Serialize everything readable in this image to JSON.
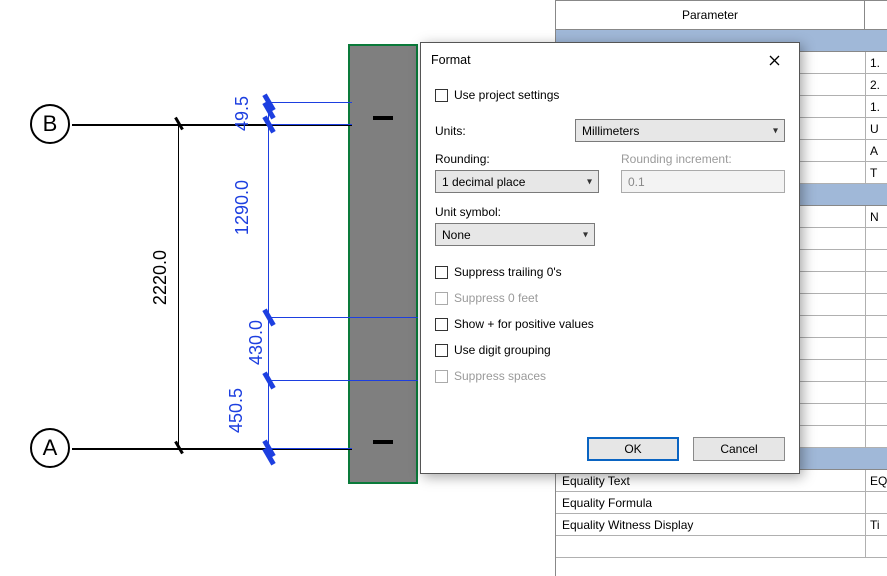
{
  "drawing": {
    "grid_labels": {
      "top": "B",
      "bottom": "A"
    },
    "dimensions": {
      "overall": "2220.0",
      "seg_top": "49.5",
      "seg_mid": "1290.0",
      "seg_430": "430.0",
      "seg_bottom": "450.5"
    }
  },
  "param_panel": {
    "header": "Parameter",
    "rows_top": [
      "1.",
      "2.",
      "1.",
      "U",
      "A",
      "T"
    ],
    "rows_mid_label": "N",
    "rows_bottom": [
      {
        "label": "Equality Text",
        "value": "EQ"
      },
      {
        "label": "Equality Formula",
        "value": ""
      },
      {
        "label": "Equality Witness Display",
        "value": "Ti"
      }
    ]
  },
  "dialog": {
    "title": "Format",
    "use_project_settings": "Use project settings",
    "units_label": "Units:",
    "units_value": "Millimeters",
    "rounding_label": "Rounding:",
    "rounding_value": "1 decimal place",
    "rounding_inc_label": "Rounding increment:",
    "rounding_inc_value": "0.1",
    "unit_symbol_label": "Unit symbol:",
    "unit_symbol_value": "None",
    "suppress_trailing": "Suppress trailing 0's",
    "suppress_0_feet": "Suppress 0 feet",
    "show_plus": "Show + for positive values",
    "digit_grouping": "Use digit grouping",
    "suppress_spaces": "Suppress spaces",
    "ok": "OK",
    "cancel": "Cancel"
  }
}
